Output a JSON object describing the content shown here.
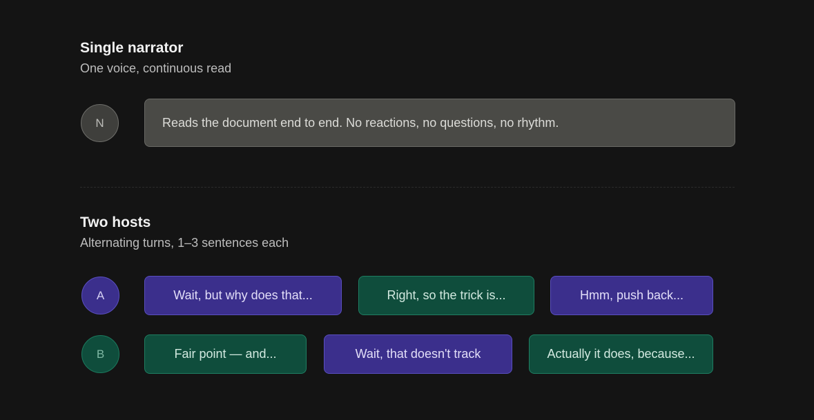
{
  "single": {
    "title": "Single narrator",
    "subtitle": "One voice, continuous read",
    "avatar": "N",
    "text": "Reads the document end to end. No reactions, no questions, no rhythm."
  },
  "two_hosts": {
    "title": "Two hosts",
    "subtitle": "Alternating turns, 1–3 sentences each",
    "row_a": {
      "avatar": "A",
      "bubbles": [
        "Wait, but why does that...",
        "Right, so the trick is...",
        "Hmm, push back..."
      ]
    },
    "row_b": {
      "avatar": "B",
      "bubbles": [
        "Fair point — and...",
        "Wait, that doesn't track",
        "Actually it does, because..."
      ]
    }
  },
  "colors": {
    "background": "#141414",
    "narrator": "#4a4a46",
    "host_a": "#3b2f8c",
    "host_b": "#0f4d3c"
  }
}
